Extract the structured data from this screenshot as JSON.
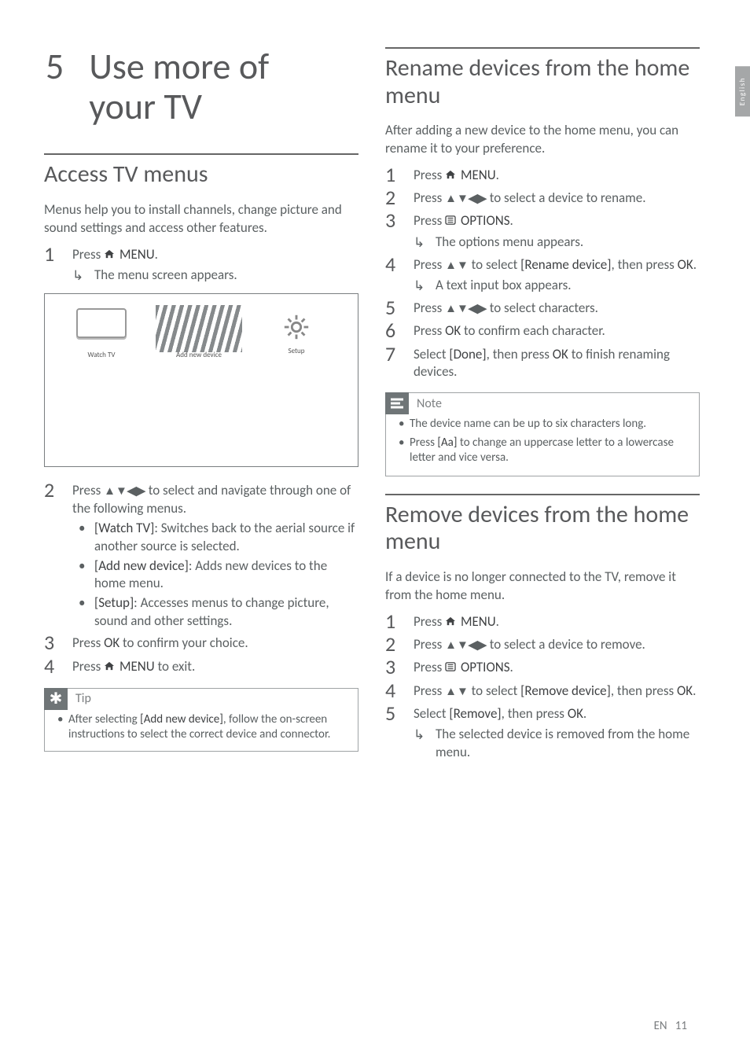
{
  "side_tab": "English",
  "footer": {
    "lang": "EN",
    "page": "11"
  },
  "chapter": {
    "num": "5",
    "title_l1": "Use more of",
    "title_l2": "your TV"
  },
  "left": {
    "section1_title": "Access TV menus",
    "intro": "Menus help you to install channels, change picture and sound settings and access other features.",
    "s1_press": "Press ",
    "s1_menu": "MENU",
    "s1_dot": ".",
    "s1_sub": "The menu screen appears.",
    "menu_items": {
      "watch": "Watch TV",
      "add": "Add new device",
      "setup": "Setup"
    },
    "s2_a": "Press ",
    "s2_b": " to select and navigate through one of the following menus.",
    "b_watch_label": "[Watch TV]",
    "b_watch_text": ": Switches back to the aerial source if another source is selected.",
    "b_add_label": "[Add new device]",
    "b_add_text": ": Adds new devices to the home menu.",
    "b_setup_label": "[Setup]",
    "b_setup_text": ": Accesses menus to change picture, sound and other settings.",
    "s3_a": "Press ",
    "s3_ok": "OK",
    "s3_b": " to confirm your choice.",
    "s4_a": "Press ",
    "s4_menu": "MENU",
    "s4_b": " to exit.",
    "tip_label": "Tip",
    "tip_a": "After selecting ",
    "tip_bold": "[Add new device]",
    "tip_b": ", follow the on-screen instructions to select the correct device and connector."
  },
  "right": {
    "sec1_title": "Rename devices from the home menu",
    "sec1_intro": "After adding a new device to the home menu, you can rename it to your preference.",
    "r1_press": "Press ",
    "r1_menu": "MENU",
    "r1_dot": ".",
    "r2_a": "Press ",
    "r2_b": " to select a device to rename.",
    "r3_a": "Press ",
    "r3_opt": "OPTIONS",
    "r3_dot": ".",
    "r3_sub": "The options menu appears.",
    "r4_a": "Press ",
    "r4_b": " to select ",
    "r4_bold": "[Rename device]",
    "r4_c": ", then press ",
    "r4_ok": "OK",
    "r4_dot": ".",
    "r4_sub": "A text input box appears.",
    "r5_a": "Press ",
    "r5_b": " to select characters.",
    "r6_a": "Press ",
    "r6_ok": "OK",
    "r6_b": " to confirm each character.",
    "r7_a": "Select ",
    "r7_bold": "[Done]",
    "r7_b": ", then press ",
    "r7_ok": "OK",
    "r7_c": " to finish renaming devices.",
    "note_label": "Note",
    "note1": "The device name can be up to six characters long.",
    "note2_a": "Press ",
    "note2_bold": "[Aa]",
    "note2_b": " to change an uppercase letter to a lowercase letter and vice versa.",
    "sec2_title": "Remove devices from the home menu",
    "sec2_intro": "If a device is no longer connected to the TV, remove it from the home menu.",
    "d1_press": "Press ",
    "d1_menu": "MENU",
    "d1_dot": ".",
    "d2_a": "Press ",
    "d2_b": " to select a device to remove.",
    "d3_a": "Press ",
    "d3_opt": "OPTIONS",
    "d3_dot": ".",
    "d4_a": "Press ",
    "d4_b": " to select ",
    "d4_bold": "[Remove device]",
    "d4_c": ", then press ",
    "d4_ok": "OK",
    "d4_dot": ".",
    "d5_a": "Select ",
    "d5_bold": "[Remove]",
    "d5_b": ", then press ",
    "d5_ok": "OK",
    "d5_dot": ".",
    "d5_sub": "The selected device is removed from the home menu."
  }
}
